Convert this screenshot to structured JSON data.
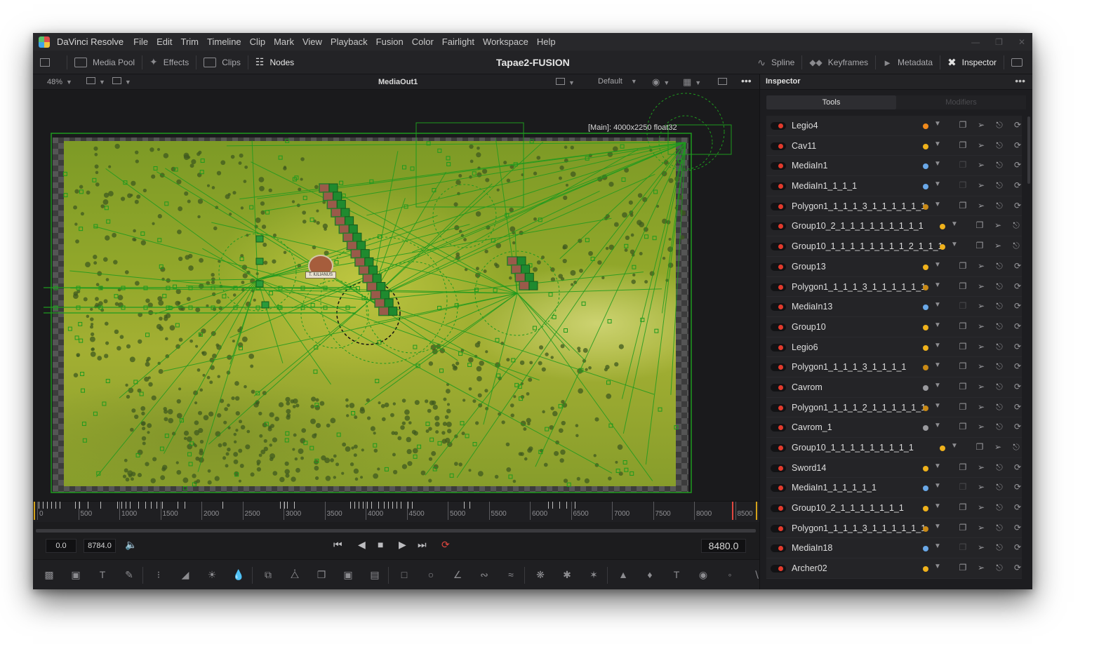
{
  "menubar": {
    "app_name": "DaVinci Resolve",
    "items": [
      "File",
      "Edit",
      "Trim",
      "Timeline",
      "Clip",
      "Mark",
      "View",
      "Playback",
      "Fusion",
      "Color",
      "Fairlight",
      "Workspace",
      "Help"
    ]
  },
  "toolbar": {
    "media_pool": "Media Pool",
    "effects": "Effects",
    "clips": "Clips",
    "nodes": "Nodes",
    "project_title": "Tapae2-FUSION",
    "spline": "Spline",
    "keyframes": "Keyframes",
    "metadata": "Metadata",
    "inspector": "Inspector"
  },
  "viewer": {
    "zoom": "48%",
    "title": "MediaOut1",
    "lut": "Default",
    "main_label": "[Main]: 4000x2250 float32",
    "badge_text": "T. IULIANUS"
  },
  "timeline": {
    "ruler_labels": [
      "0",
      "500",
      "1000",
      "1500",
      "2000",
      "2500",
      "3000",
      "3500",
      "4000",
      "4500",
      "5000",
      "5500",
      "6000",
      "6500",
      "7000",
      "7500",
      "8000",
      "8500"
    ],
    "start_time": "0.0",
    "end_time": "8784.0",
    "current_time": "8480.0"
  },
  "inspector": {
    "title": "Inspector",
    "tabs": {
      "tools": "Tools",
      "modifiers": "Modifiers"
    },
    "tools": [
      {
        "name": "Legio4",
        "dot": "#f08a1c"
      },
      {
        "name": "Cav11",
        "dot": "#f0b21c"
      },
      {
        "name": "MediaIn1",
        "dot": "#6aa8e8"
      },
      {
        "name": "MediaIn1_1_1_1",
        "dot": "#6aa8e8"
      },
      {
        "name": "Polygon1_1_1_1_3_1_1_1_1_1_1",
        "dot": "#c98a16"
      },
      {
        "name": "Group10_2_1_1_1_1_1_1_1_1_1",
        "dot": "#f0b21c"
      },
      {
        "name": "Group10_1_1_1_1_1_1_1_1_2_1_1_1",
        "dot": "#f0b21c"
      },
      {
        "name": "Group13",
        "dot": "#f0b21c"
      },
      {
        "name": "Polygon1_1_1_1_3_1_1_1_1_1_1",
        "dot": "#c98a16"
      },
      {
        "name": "MediaIn13",
        "dot": "#6aa8e8"
      },
      {
        "name": "Group10",
        "dot": "#f0b21c"
      },
      {
        "name": "Legio6",
        "dot": "#f0b21c"
      },
      {
        "name": "Polygon1_1_1_1_3_1_1_1_1",
        "dot": "#c98a16"
      },
      {
        "name": "Cavrom",
        "dot": "#9a9a9e"
      },
      {
        "name": "Polygon1_1_1_1_2_1_1_1_1_1_1",
        "dot": "#c98a16"
      },
      {
        "name": "Cavrom_1",
        "dot": "#9a9a9e"
      },
      {
        "name": "Group10_1_1_1_1_1_1_1_1_1",
        "dot": "#f0b21c"
      },
      {
        "name": "Sword14",
        "dot": "#f0b21c"
      },
      {
        "name": "MediaIn1_1_1_1_1_1",
        "dot": "#6aa8e8"
      },
      {
        "name": "Group10_2_1_1_1_1_1_1_1",
        "dot": "#f0b21c"
      },
      {
        "name": "Polygon1_1_1_1_3_1_1_1_1_1_1",
        "dot": "#c98a16"
      },
      {
        "name": "MediaIn18",
        "dot": "#6aa8e8"
      },
      {
        "name": "Archer02",
        "dot": "#f0b21c"
      }
    ]
  },
  "colors": {
    "accent_red": "#e23a2c",
    "overlay_green": "#1e9a1e"
  }
}
